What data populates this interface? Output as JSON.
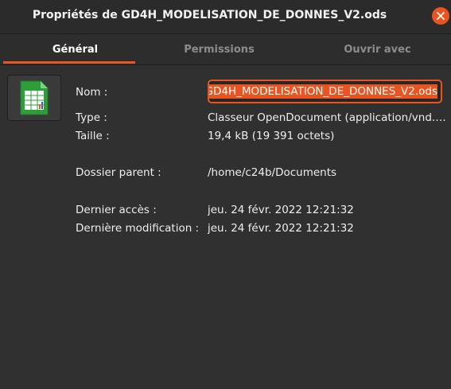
{
  "window": {
    "title": "Propriétés de GD4H_MODELISATION_DE_DONNES_V2.ods"
  },
  "tabs": [
    {
      "label": "Général",
      "active": true
    },
    {
      "label": "Permissions",
      "active": false
    },
    {
      "label": "Ouvrir avec",
      "active": false
    }
  ],
  "file": {
    "icon": "spreadsheet-file-icon",
    "name_label": "Nom :",
    "name_value": "GD4H_MODELISATION_DE_DONNES_V2.ods",
    "type_label": "Type :",
    "type_value": "Classeur OpenDocument (application/vnd.oasis.opendocument.spreadsheet)",
    "size_label": "Taille :",
    "size_value": "19,4 kB (19 391 octets)",
    "parent_label": "Dossier parent :",
    "parent_value": "/home/c24b/Documents",
    "accessed_label": "Dernier accès :",
    "accessed_value": "jeu. 24 févr. 2022 12:21:32",
    "modified_label": "Dernière modification :",
    "modified_value": "jeu. 24 févr. 2022 12:21:32"
  },
  "colors": {
    "accent": "#e95420",
    "background": "#303030",
    "icon_green": "#2e9e3a"
  }
}
